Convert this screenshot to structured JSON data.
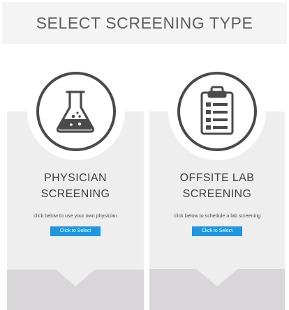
{
  "header": {
    "title": "SELECT SCREENING TYPE"
  },
  "cards": [
    {
      "title_line1": "PHYSICIAN",
      "title_line2": "SCREENING",
      "description": "click below to use your own physician",
      "button_label": "Click to Select",
      "icon": "flask-icon"
    },
    {
      "title_line1": "OFFSITE LAB",
      "title_line2": "SCREENING",
      "description": "click below to schedule a lab screening",
      "button_label": "Click to Select",
      "icon": "clipboard-icon"
    }
  ],
  "colors": {
    "button": "#1d97e3",
    "card_background": "#eeeeee",
    "card_footer": "#d8d6d8",
    "icon_stroke": "#4a4a4a"
  }
}
